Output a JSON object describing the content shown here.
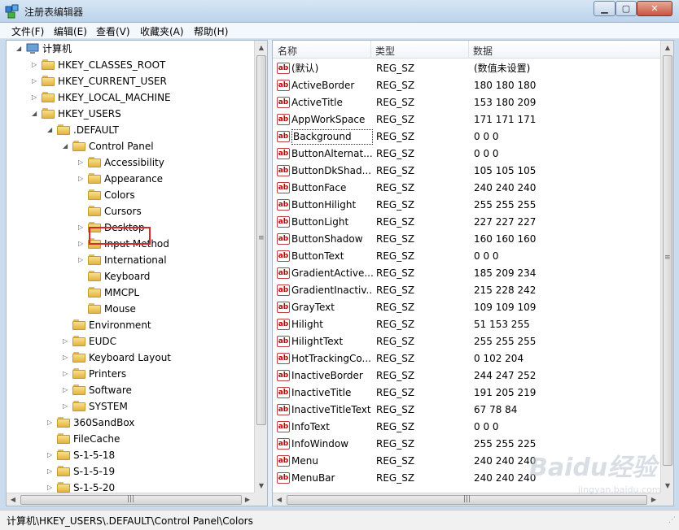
{
  "window": {
    "title": "注册表编辑器",
    "min_glyph": "▁",
    "max_glyph": "▢",
    "close_glyph": "✕"
  },
  "menu": [
    "文件(F)",
    "编辑(E)",
    "查看(V)",
    "收藏夹(A)",
    "帮助(H)"
  ],
  "tree": [
    {
      "label": "计算机",
      "level": 0,
      "expander": "◢",
      "icon": "computer-icon"
    },
    {
      "label": "HKEY_CLASSES_ROOT",
      "level": 1,
      "expander": "▷",
      "icon": "folder-icon"
    },
    {
      "label": "HKEY_CURRENT_USER",
      "level": 1,
      "expander": "▷",
      "icon": "folder-icon"
    },
    {
      "label": "HKEY_LOCAL_MACHINE",
      "level": 1,
      "expander": "▷",
      "icon": "folder-icon"
    },
    {
      "label": "HKEY_USERS",
      "level": 1,
      "expander": "◢",
      "icon": "folder-icon"
    },
    {
      "label": ".DEFAULT",
      "level": 2,
      "expander": "◢",
      "icon": "folder-icon"
    },
    {
      "label": "Control Panel",
      "level": 3,
      "expander": "◢",
      "icon": "folder-icon"
    },
    {
      "label": "Accessibility",
      "level": 4,
      "expander": "▷",
      "icon": "folder-icon"
    },
    {
      "label": "Appearance",
      "level": 4,
      "expander": "▷",
      "icon": "folder-icon"
    },
    {
      "label": "Colors",
      "level": 4,
      "expander": "",
      "icon": "folder-icon",
      "selected": true
    },
    {
      "label": "Cursors",
      "level": 4,
      "expander": "",
      "icon": "folder-icon"
    },
    {
      "label": "Desktop",
      "level": 4,
      "expander": "▷",
      "icon": "folder-icon"
    },
    {
      "label": "Input Method",
      "level": 4,
      "expander": "▷",
      "icon": "folder-icon"
    },
    {
      "label": "International",
      "level": 4,
      "expander": "▷",
      "icon": "folder-icon"
    },
    {
      "label": "Keyboard",
      "level": 4,
      "expander": "",
      "icon": "folder-icon"
    },
    {
      "label": "MMCPL",
      "level": 4,
      "expander": "",
      "icon": "folder-icon"
    },
    {
      "label": "Mouse",
      "level": 4,
      "expander": "",
      "icon": "folder-icon"
    },
    {
      "label": "Environment",
      "level": 3,
      "expander": "",
      "icon": "folder-icon"
    },
    {
      "label": "EUDC",
      "level": 3,
      "expander": "▷",
      "icon": "folder-icon"
    },
    {
      "label": "Keyboard Layout",
      "level": 3,
      "expander": "▷",
      "icon": "folder-icon"
    },
    {
      "label": "Printers",
      "level": 3,
      "expander": "▷",
      "icon": "folder-icon"
    },
    {
      "label": "Software",
      "level": 3,
      "expander": "▷",
      "icon": "folder-icon"
    },
    {
      "label": "SYSTEM",
      "level": 3,
      "expander": "▷",
      "icon": "folder-icon"
    },
    {
      "label": "360SandBox",
      "level": 2,
      "expander": "▷",
      "icon": "folder-icon"
    },
    {
      "label": "FileCache",
      "level": 2,
      "expander": "",
      "icon": "folder-icon"
    },
    {
      "label": "S-1-5-18",
      "level": 2,
      "expander": "▷",
      "icon": "folder-icon"
    },
    {
      "label": "S-1-5-19",
      "level": 2,
      "expander": "▷",
      "icon": "folder-icon"
    },
    {
      "label": "S-1-5-20",
      "level": 2,
      "expander": "▷",
      "icon": "folder-icon"
    }
  ],
  "list": {
    "columns": [
      "名称",
      "类型",
      "数据"
    ],
    "rows": [
      {
        "name": "(默认)",
        "type": "REG_SZ",
        "data": "(数值未设置)"
      },
      {
        "name": "ActiveBorder",
        "type": "REG_SZ",
        "data": "180 180 180"
      },
      {
        "name": "ActiveTitle",
        "type": "REG_SZ",
        "data": "153 180 209"
      },
      {
        "name": "AppWorkSpace",
        "type": "REG_SZ",
        "data": "171 171 171"
      },
      {
        "name": "Background",
        "type": "REG_SZ",
        "data": "0 0 0",
        "focused": true
      },
      {
        "name": "ButtonAlternat...",
        "type": "REG_SZ",
        "data": "0 0 0"
      },
      {
        "name": "ButtonDkShad...",
        "type": "REG_SZ",
        "data": "105 105 105"
      },
      {
        "name": "ButtonFace",
        "type": "REG_SZ",
        "data": "240 240 240"
      },
      {
        "name": "ButtonHilight",
        "type": "REG_SZ",
        "data": "255 255 255"
      },
      {
        "name": "ButtonLight",
        "type": "REG_SZ",
        "data": "227 227 227"
      },
      {
        "name": "ButtonShadow",
        "type": "REG_SZ",
        "data": "160 160 160"
      },
      {
        "name": "ButtonText",
        "type": "REG_SZ",
        "data": "0 0 0"
      },
      {
        "name": "GradientActive...",
        "type": "REG_SZ",
        "data": "185 209 234"
      },
      {
        "name": "GradientInactiv...",
        "type": "REG_SZ",
        "data": "215 228 242"
      },
      {
        "name": "GrayText",
        "type": "REG_SZ",
        "data": "109 109 109"
      },
      {
        "name": "Hilight",
        "type": "REG_SZ",
        "data": "51 153 255"
      },
      {
        "name": "HilightText",
        "type": "REG_SZ",
        "data": "255 255 255"
      },
      {
        "name": "HotTrackingCo...",
        "type": "REG_SZ",
        "data": "0 102 204"
      },
      {
        "name": "InactiveBorder",
        "type": "REG_SZ",
        "data": "244 247 252"
      },
      {
        "name": "InactiveTitle",
        "type": "REG_SZ",
        "data": "191 205 219"
      },
      {
        "name": "InactiveTitleText",
        "type": "REG_SZ",
        "data": "67 78 84"
      },
      {
        "name": "InfoText",
        "type": "REG_SZ",
        "data": "0 0 0"
      },
      {
        "name": "InfoWindow",
        "type": "REG_SZ",
        "data": "255 255 225"
      },
      {
        "name": "Menu",
        "type": "REG_SZ",
        "data": "240 240 240"
      },
      {
        "name": "MenuBar",
        "type": "REG_SZ",
        "data": "240 240 240"
      }
    ]
  },
  "status": {
    "path": "计算机\\HKEY_USERS\\.DEFAULT\\Control Panel\\Colors"
  },
  "watermark": {
    "main": "Baidu经验",
    "sub": "jingyan.baidu.com"
  },
  "colors": {
    "selection_highlight": "#d9282c",
    "registry_icon_red": "#b00000"
  }
}
